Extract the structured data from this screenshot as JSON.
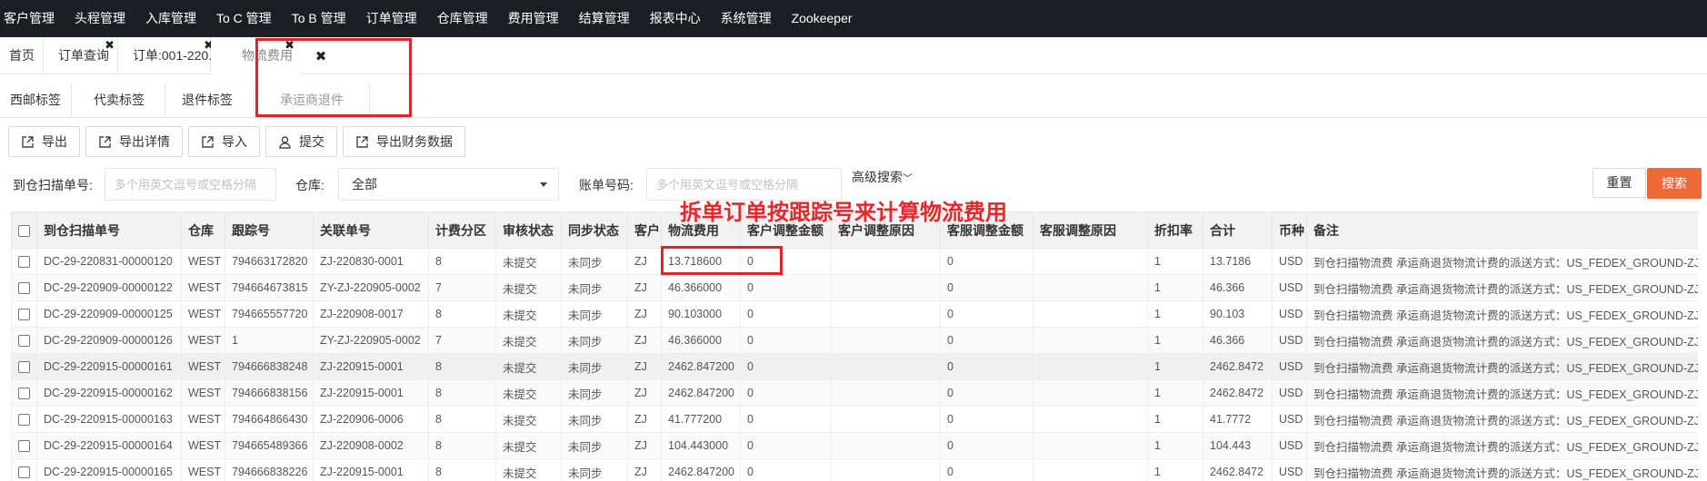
{
  "nav": [
    "客户管理",
    "头程管理",
    "入库管理",
    "To C 管理",
    "To B 管理",
    "订单管理",
    "仓库管理",
    "费用管理",
    "结算管理",
    "报表中心",
    "系统管理",
    "Zookeeper"
  ],
  "tabs": [
    {
      "label": "首页"
    },
    {
      "label": "订单查询"
    },
    {
      "label": "订单:001-220..."
    },
    {
      "label": "物流费用"
    }
  ],
  "tab_close_symbol": "✖",
  "subtabs": [
    "西邮标签",
    "代卖标签",
    "退件标签",
    "承运商退件"
  ],
  "toolbar": [
    {
      "label": "导出",
      "icon": "export-icon"
    },
    {
      "label": "导出详情",
      "icon": "export-icon"
    },
    {
      "label": "导入",
      "icon": "export-icon"
    },
    {
      "label": "提交",
      "icon": "user-icon"
    },
    {
      "label": "导出财务数据",
      "icon": "export-icon"
    }
  ],
  "search": {
    "scan_label": "到仓扫描单号:",
    "scan_placeholder": "多个用英文逗号或空格分隔",
    "warehouse_label": "仓库:",
    "warehouse_value": "全部",
    "bill_label": "账单号码:",
    "bill_placeholder": "多个用英文逗号或空格分隔",
    "advanced": "高级搜索",
    "reset": "重置",
    "submit": "搜索"
  },
  "annotation": "拆单订单按跟踪号来计算物流费用",
  "table": {
    "headers": [
      "到仓扫描单号",
      "仓库",
      "跟踪号",
      "关联单号",
      "计费分区",
      "审核状态",
      "同步状态",
      "客户",
      "物流费用",
      "客户调整金额",
      "客户调整原因",
      "客服调整金额",
      "客服调整原因",
      "折扣率",
      "合计",
      "币种",
      "备注"
    ],
    "rows": [
      [
        "DC-29-220831-00000120",
        "WEST",
        "794663172820",
        "ZJ-220830-0001",
        "8",
        "未提交",
        "未同步",
        "ZJ",
        "13.718600",
        "0",
        "",
        "0",
        "",
        "1",
        "13.7186",
        "USD",
        "到仓扫描物流费 承运商退货物流计费的派送方式：US_FEDEX_GROUND-ZJ"
      ],
      [
        "DC-29-220909-00000122",
        "WEST",
        "794664673815",
        "ZY-ZJ-220905-0002",
        "7",
        "未提交",
        "未同步",
        "ZJ",
        "46.366000",
        "0",
        "",
        "0",
        "",
        "1",
        "46.366",
        "USD",
        "到仓扫描物流费 承运商退货物流计费的派送方式：US_FEDEX_GROUND-ZJ"
      ],
      [
        "DC-29-220909-00000125",
        "WEST",
        "794665557720",
        "ZJ-220908-0017",
        "8",
        "未提交",
        "未同步",
        "ZJ",
        "90.103000",
        "0",
        "",
        "0",
        "",
        "1",
        "90.103",
        "USD",
        "到仓扫描物流费 承运商退货物流计费的派送方式：US_FEDEX_GROUND-ZJ"
      ],
      [
        "DC-29-220909-00000126",
        "WEST",
        "1",
        "ZY-ZJ-220905-0002",
        "7",
        "未提交",
        "未同步",
        "ZJ",
        "46.366000",
        "0",
        "",
        "0",
        "",
        "1",
        "46.366",
        "USD",
        "到仓扫描物流费 承运商退货物流计费的派送方式：US_FEDEX_GROUND-ZJ"
      ],
      [
        "DC-29-220915-00000161",
        "WEST",
        "794666838248",
        "ZJ-220915-0001",
        "8",
        "未提交",
        "未同步",
        "ZJ",
        "2462.847200",
        "0",
        "",
        "0",
        "",
        "1",
        "2462.8472",
        "USD",
        "到仓扫描物流费 承运商退货物流计费的派送方式：US_FEDEX_GROUND-ZJ"
      ],
      [
        "DC-29-220915-00000162",
        "WEST",
        "794666838156",
        "ZJ-220915-0001",
        "8",
        "未提交",
        "未同步",
        "ZJ",
        "2462.847200",
        "0",
        "",
        "0",
        "",
        "1",
        "2462.8472",
        "USD",
        "到仓扫描物流费 承运商退货物流计费的派送方式：US_FEDEX_GROUND-ZJ"
      ],
      [
        "DC-29-220915-00000163",
        "WEST",
        "794664866430",
        "ZJ-220906-0006",
        "8",
        "未提交",
        "未同步",
        "ZJ",
        "41.777200",
        "0",
        "",
        "0",
        "",
        "1",
        "41.7772",
        "USD",
        "到仓扫描物流费 承运商退货物流计费的派送方式：US_FEDEX_GROUND-ZJ"
      ],
      [
        "DC-29-220915-00000164",
        "WEST",
        "794665489366",
        "ZJ-220908-0002",
        "8",
        "未提交",
        "未同步",
        "ZJ",
        "104.443000",
        "0",
        "",
        "0",
        "",
        "1",
        "104.443",
        "USD",
        "到仓扫描物流费 承运商退货物流计费的派送方式：US_FEDEX_GROUND-ZJ"
      ],
      [
        "DC-29-220915-00000165",
        "WEST",
        "794666838226",
        "ZJ-220915-0001",
        "8",
        "未提交",
        "未同步",
        "ZJ",
        "2462.847200",
        "0",
        "",
        "0",
        "",
        "1",
        "2462.8472",
        "USD",
        "到仓扫描物流费 承运商退货物流计费的派送方式：US_FEDEX_GROUND-ZJ"
      ]
    ]
  },
  "colors": {
    "accent": "#ee6a3a",
    "annotation": "#e8262b",
    "nav_bg": "#1b1f24"
  }
}
